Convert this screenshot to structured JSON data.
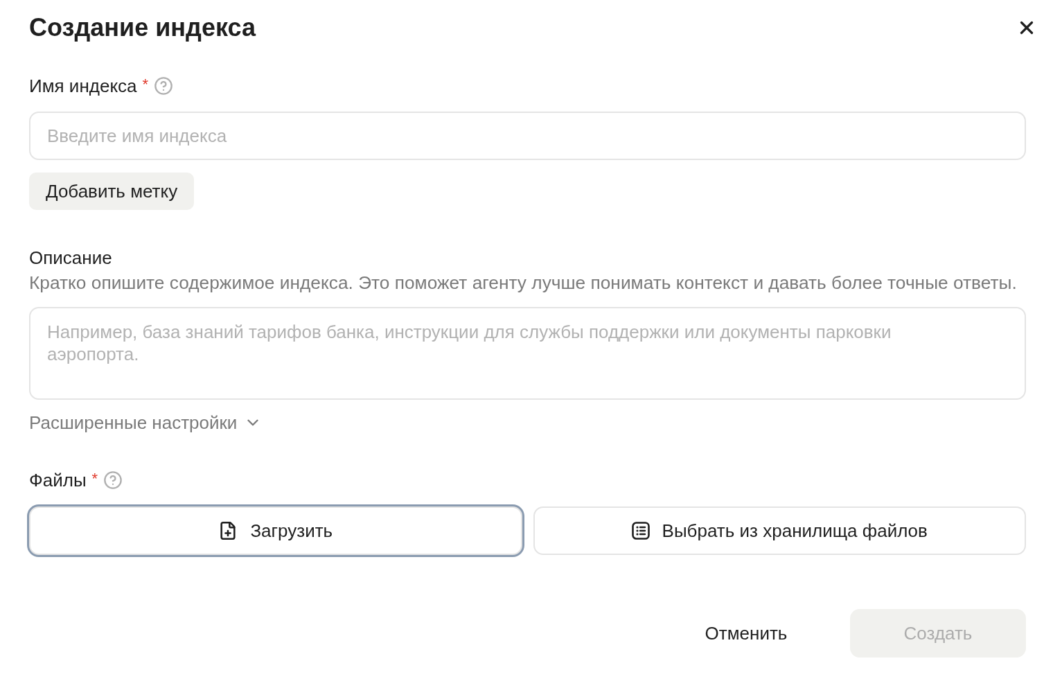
{
  "dialog": {
    "title": "Создание индекса"
  },
  "name_field": {
    "label": "Имя индекса",
    "required_mark": "*",
    "placeholder": "Введите имя индекса"
  },
  "add_tag_button": {
    "label": "Добавить метку"
  },
  "description": {
    "label": "Описание",
    "hint": "Кратко опишите содержимое индекса. Это поможет агенту лучше понимать контекст и давать более точные ответы.",
    "placeholder": "Например, база знаний тарифов банка, инструкции для службы поддержки или документы парковки аэропорта."
  },
  "advanced_settings": {
    "label": "Расширенные настройки",
    "expanded": false
  },
  "files": {
    "label": "Файлы",
    "required_mark": "*",
    "buttons": [
      {
        "kind": "upload",
        "label": "Загрузить",
        "focused": true
      },
      {
        "kind": "storage",
        "label": "Выбрать из хранилища файлов",
        "focused": false
      }
    ]
  },
  "footer": {
    "buttons": [
      {
        "kind": "text",
        "label": "Отменить",
        "disabled": false
      },
      {
        "kind": "primary",
        "label": "Создать",
        "disabled": true
      }
    ]
  }
}
